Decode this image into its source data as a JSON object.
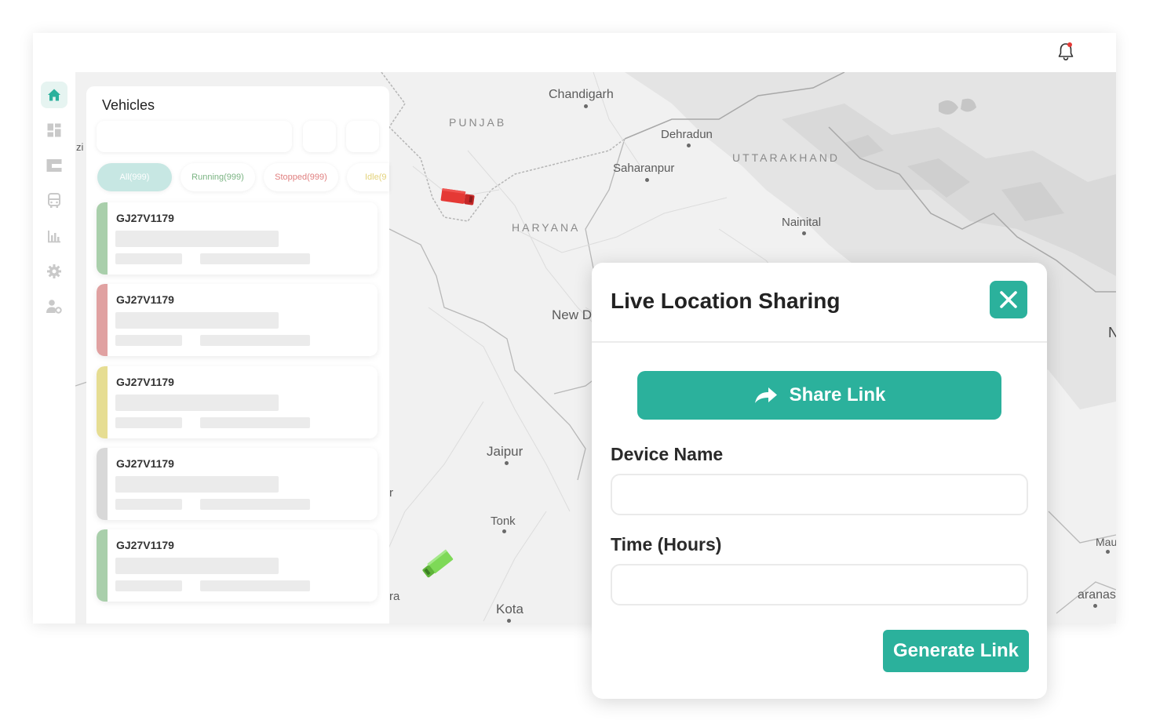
{
  "header": {
    "notification_icon": "bell-icon",
    "notification_dot_color": "#e53935"
  },
  "sidebar": {
    "items": [
      {
        "icon": "home-icon",
        "active": true
      },
      {
        "icon": "dashboard-icon",
        "active": false
      },
      {
        "icon": "layout-icon",
        "active": false
      },
      {
        "icon": "bus-icon",
        "active": false
      },
      {
        "icon": "bar-chart-icon",
        "active": false
      },
      {
        "icon": "gear-icon",
        "active": false
      },
      {
        "icon": "user-settings-icon",
        "active": false
      }
    ]
  },
  "vehicles_panel": {
    "title": "Vehicles",
    "filters": [
      {
        "label": "All(999)",
        "color": "#ffffff",
        "bg": "#c7e7e3"
      },
      {
        "label": "Running(999)",
        "color": "#7bb483",
        "bg": "#ffffff"
      },
      {
        "label": "Stopped(999)",
        "color": "#e07f7f",
        "bg": "#ffffff"
      },
      {
        "label": "Idle(9",
        "color": "#e3d27a",
        "bg": "#ffffff"
      }
    ],
    "vehicles": [
      {
        "id": "GJ27V1179",
        "status_color": "#a9cfab"
      },
      {
        "id": "GJ27V1179",
        "status_color": "#e0a1a1"
      },
      {
        "id": "GJ27V1179",
        "status_color": "#e6dd92"
      },
      {
        "id": "GJ27V1179",
        "status_color": "#d8d8d8"
      },
      {
        "id": "GJ27V1179",
        "status_color": "#a9cfab"
      }
    ]
  },
  "map": {
    "labels": {
      "chandigarh": "Chandigarh",
      "punjab": "PUNJAB",
      "dehradun": "Dehradun",
      "uttarakhand": "UTTARAKHAND",
      "saharanpur": "Saharanpur",
      "haryana": "HARYANA",
      "nainital": "Nainital",
      "new_delhi": "New Delhi",
      "jaipur": "Jaipur",
      "tonk": "Tonk",
      "kota": "Kota",
      "varanasi": "aranasi",
      "mau": "Mau",
      "edge_zi": "zi",
      "edge_r": "r",
      "edge_ra": "ra",
      "edge_n": "N"
    },
    "markers": [
      {
        "name": "truck-stopped",
        "color": "#e53935"
      },
      {
        "name": "truck-running",
        "color": "#7ed957"
      }
    ]
  },
  "modal": {
    "title": "Live Location Sharing",
    "close_icon": "close-icon",
    "share_button": "Share Link",
    "device_name_label": "Device Name",
    "device_name_value": "",
    "time_label": "Time (Hours)",
    "time_value": "",
    "generate_button": "Generate Link",
    "accent_color": "#2bb19c"
  }
}
